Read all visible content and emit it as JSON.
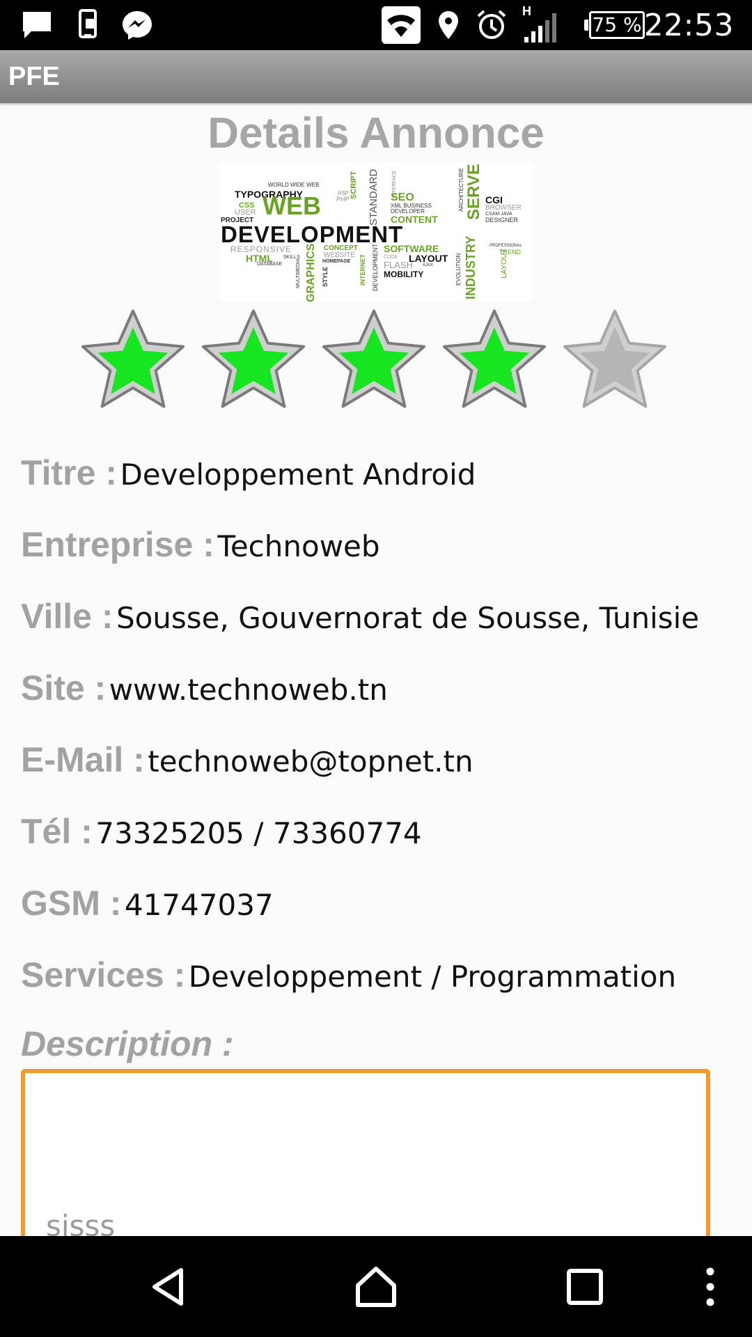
{
  "status_bar": {
    "time": "22:53",
    "battery": "75 %",
    "network_letter": "H",
    "icons": [
      "message-icon",
      "phone-sync-icon",
      "messenger-icon",
      "wifi-icon",
      "location-icon",
      "alarm-icon",
      "signal-icon",
      "battery-icon"
    ]
  },
  "app_bar": {
    "title": "PFE"
  },
  "page": {
    "heading": "Details Annonce"
  },
  "hero_image": {
    "words": {
      "typography": "TYPOGRAPHY",
      "world": "WORLD WIDE WEB",
      "css": "CSS",
      "user": "USER",
      "project": "PROJECT",
      "web": "WEB",
      "asp": "ASP",
      "php": "PHP",
      "script": "SCRIPT",
      "standard": "STANDARD",
      "interface": "INTERFACE",
      "seo": "SEO",
      "xml": "XML BUSINESS",
      "developer": "DEVELOPER",
      "content": "CONTENT",
      "architecture": "ARCHITECTURE",
      "server": "SERVER",
      "cgi": "CGI",
      "browser": "BROWSER",
      "java": "CSAM JAVA",
      "designer": "DESIGNER",
      "development": "DEVELOPMENT",
      "responsive": "RESPONSIVE",
      "concept": "CONCEPT",
      "software": "SOFTWARE",
      "professional": "PROFESSIONAL",
      "trend": "TREND",
      "html": "HTML",
      "skills": "SKILLS",
      "website": "WEBSITE",
      "homepage": "HOMEPAGE",
      "layout": "LAYOUT",
      "database": "DATABASE",
      "code": "CODE",
      "flash": "FLASH",
      "ajax": "AJAX",
      "mobility": "MOBILITY",
      "graphics": "GRAPHICS",
      "multimedia": "MULTIMEDIA",
      "style": "STYLE",
      "internet": "INTERNET",
      "development_v": "DEVELOPMENT",
      "evolution": "EVOLUTION",
      "industry": "INDUSTRY",
      "layout_v": "LAYOUT"
    }
  },
  "rating": {
    "value": 4,
    "max": 5,
    "filled_color": "#15e61f",
    "empty_color": "#b5b5b5"
  },
  "details": {
    "titre": {
      "label": "Titre :",
      "value": "Developpement Android"
    },
    "entreprise": {
      "label": "Entreprise :",
      "value": "Technoweb"
    },
    "ville": {
      "label": "Ville :",
      "value": "Sousse, Gouvernorat de Sousse, Tunisie"
    },
    "site": {
      "label": "Site :",
      "value": "www.technoweb.tn"
    },
    "email": {
      "label": "E-Mail :",
      "value": "technoweb@topnet.tn"
    },
    "tel": {
      "label": "Tél :",
      "value": "73325205 / 73360774"
    },
    "gsm": {
      "label": "GSM :",
      "value": "41747037"
    },
    "services": {
      "label": "Services :",
      "value": "Developpement / Programmation"
    }
  },
  "description": {
    "label": "Description :",
    "value": "sisss",
    "border_color": "#f39a2d"
  },
  "nav_bar": {
    "icons": [
      "back-icon",
      "home-icon",
      "recents-icon",
      "more-icon"
    ]
  }
}
